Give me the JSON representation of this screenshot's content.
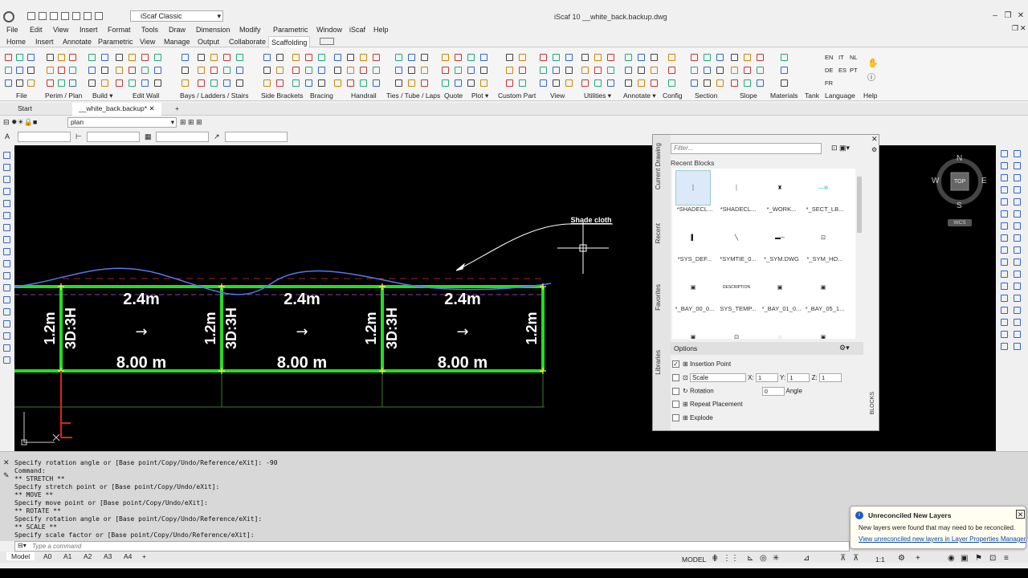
{
  "app": {
    "title": "iScaf 10     __white_back.backup.dwg",
    "workspace": "iScaf Classic"
  },
  "menu": [
    "File",
    "Edit",
    "View",
    "Insert",
    "Format",
    "Tools",
    "Draw",
    "Dimension",
    "Modify",
    "Parametric",
    "Window",
    "iScaf",
    "Help"
  ],
  "ribbon_tabs": [
    "Home",
    "Insert",
    "Annotate",
    "Parametric",
    "View",
    "Manage",
    "Output",
    "Collaborate",
    "Scaffolding"
  ],
  "ribbon_active": "Scaffolding",
  "ribbon_groups": [
    "File",
    "Perim / Plan",
    "Build ▾",
    "Edit Wall",
    "Bays / Ladders / Stairs",
    "Side Brackets",
    "Bracing",
    "Handrail",
    "Ties / Tube / Laps",
    "Quote",
    "Plot ▾",
    "Custom Part",
    "View",
    "Utilities ▾",
    "Annotate ▾",
    "Config",
    "Section",
    "Slope",
    "Materials",
    "Tank",
    "Language",
    "Help"
  ],
  "languages": [
    "EN",
    "IT",
    "NL",
    "DE",
    "ES",
    "PT",
    "FR"
  ],
  "doc_tabs": {
    "start": "Start",
    "file": "__white_back.backup*"
  },
  "layer": "plan",
  "drawing": {
    "bay_widths": [
      "2.4m",
      "2.4m",
      "2.4m"
    ],
    "bay_lengths": [
      "8.00 m",
      "8.00 m",
      "8.00 m"
    ],
    "depth_labels": [
      "1.2m",
      "1.2m",
      "1.2m",
      "1.2m"
    ],
    "height_labels": [
      "3D:3H",
      "3D:3H",
      "3D:3H"
    ],
    "arrow": "→",
    "annotation": "Shade cloth",
    "line_color": "#22dd22",
    "curve_color": "#5577ee"
  },
  "compass": {
    "n": "N",
    "s": "S",
    "e": "E",
    "w": "W",
    "center": "TOP",
    "wcs": "WCS"
  },
  "palette": {
    "filter_placeholder": "Filter...",
    "recent_header": "Recent Blocks",
    "side_tabs": [
      "Current Drawing",
      "Recent",
      "Favorites",
      "Libraries"
    ],
    "blocks_tab": "BLOCKS",
    "blocks": [
      "*SHADECL...",
      "*SHADECL...",
      "*_WORK...",
      "*_SECT_LB...",
      "*SYS_DEF...",
      "*SYMTIE_0...",
      "*_SYM.DWG",
      "*_SYM_HO...",
      "*_BAY_00_0...",
      "SYS_TEMP...",
      "*_BAY_01_0...",
      "*_BAY_05_1..."
    ],
    "description_thumb": "DESCRIPTION",
    "options_header": "Options",
    "options": {
      "insertion_point": "Insertion Point",
      "scale": "Scale",
      "x_label": "X:",
      "y_label": "Y:",
      "z_label": "Z:",
      "x": "1",
      "y": "1",
      "z": "1",
      "rotation": "Rotation",
      "rotation_value": "0",
      "angle": "Angle",
      "repeat": "Repeat Placement",
      "explode": "Explode"
    }
  },
  "command_history": [
    "Specify rotation angle or [Base point/Copy/Undo/Reference/eXit]: -90",
    "Command:",
    "** STRETCH **",
    "Specify stretch point or [Base point/Copy/Undo/eXit]:",
    "** MOVE **",
    "Specify move point or [Base point/Copy/Undo/eXit]:",
    "** ROTATE **",
    "Specify rotation angle or [Base point/Copy/Undo/Reference/eXit]:",
    "** SCALE **",
    "Specify scale factor or [Base point/Copy/Undo/Reference/eXit]:"
  ],
  "command_placeholder": "Type a command",
  "layout_tabs": [
    "Model",
    "A0",
    "A1",
    "A2",
    "A3",
    "A4"
  ],
  "status": {
    "model": "MODEL",
    "scale": "1:1"
  },
  "notification": {
    "title": "Unreconciled New Layers",
    "body": "New layers were found that may need to be reconciled.",
    "link": "View unreconciled new layers in Layer Properties Manager"
  }
}
